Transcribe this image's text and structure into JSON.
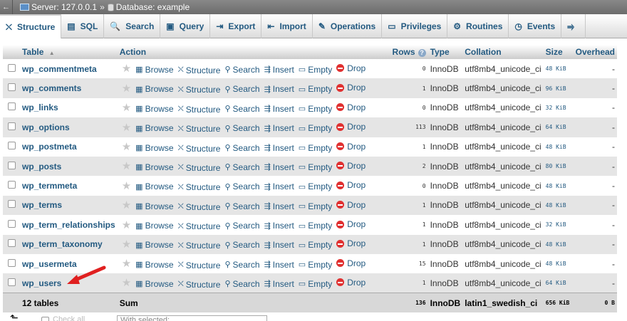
{
  "breadcrumb": {
    "back": "←",
    "server": "Server: 127.0.0.1",
    "separator": "»",
    "database": "Database: example"
  },
  "tabs": [
    {
      "label": "Structure",
      "icon": "structure-icon",
      "glyph": "⛌",
      "active": true
    },
    {
      "label": "SQL",
      "icon": "sql-icon",
      "glyph": "▤"
    },
    {
      "label": "Search",
      "icon": "search-icon",
      "glyph": "🔍"
    },
    {
      "label": "Query",
      "icon": "query-icon",
      "glyph": "▣"
    },
    {
      "label": "Export",
      "icon": "export-icon",
      "glyph": "⇥"
    },
    {
      "label": "Import",
      "icon": "import-icon",
      "glyph": "⇤"
    },
    {
      "label": "Operations",
      "icon": "operations-icon",
      "glyph": "✎"
    },
    {
      "label": "Privileges",
      "icon": "privileges-icon",
      "glyph": "▭"
    },
    {
      "label": "Routines",
      "icon": "routines-icon",
      "glyph": "⚙"
    },
    {
      "label": "Events",
      "icon": "events-icon",
      "glyph": "◷"
    },
    {
      "label": "",
      "icon": "triggers-icon",
      "glyph": "⥤"
    }
  ],
  "table": {
    "headers": {
      "table": "Table",
      "sort_indicator": "▲",
      "action": "Action",
      "rows": "Rows",
      "type": "Type",
      "collation": "Collation",
      "size": "Size",
      "overhead": "Overhead"
    },
    "actions": {
      "browse": "Browse",
      "structure": "Structure",
      "search": "Search",
      "insert": "Insert",
      "empty": "Empty",
      "drop": "Drop"
    },
    "rows": [
      {
        "name": "wp_commentmeta",
        "rows": "0",
        "type": "InnoDB",
        "collation": "utf8mb4_unicode_ci",
        "size": "48 KiB",
        "overhead": "-"
      },
      {
        "name": "wp_comments",
        "rows": "1",
        "type": "InnoDB",
        "collation": "utf8mb4_unicode_ci",
        "size": "96 KiB",
        "overhead": "-"
      },
      {
        "name": "wp_links",
        "rows": "0",
        "type": "InnoDB",
        "collation": "utf8mb4_unicode_ci",
        "size": "32 KiB",
        "overhead": "-"
      },
      {
        "name": "wp_options",
        "rows": "113",
        "type": "InnoDB",
        "collation": "utf8mb4_unicode_ci",
        "size": "64 KiB",
        "overhead": "-"
      },
      {
        "name": "wp_postmeta",
        "rows": "1",
        "type": "InnoDB",
        "collation": "utf8mb4_unicode_ci",
        "size": "48 KiB",
        "overhead": "-"
      },
      {
        "name": "wp_posts",
        "rows": "2",
        "type": "InnoDB",
        "collation": "utf8mb4_unicode_ci",
        "size": "80 KiB",
        "overhead": "-"
      },
      {
        "name": "wp_termmeta",
        "rows": "0",
        "type": "InnoDB",
        "collation": "utf8mb4_unicode_ci",
        "size": "48 KiB",
        "overhead": "-"
      },
      {
        "name": "wp_terms",
        "rows": "1",
        "type": "InnoDB",
        "collation": "utf8mb4_unicode_ci",
        "size": "48 KiB",
        "overhead": "-"
      },
      {
        "name": "wp_term_relationships",
        "rows": "1",
        "type": "InnoDB",
        "collation": "utf8mb4_unicode_ci",
        "size": "32 KiB",
        "overhead": "-"
      },
      {
        "name": "wp_term_taxonomy",
        "rows": "1",
        "type": "InnoDB",
        "collation": "utf8mb4_unicode_ci",
        "size": "48 KiB",
        "overhead": "-"
      },
      {
        "name": "wp_usermeta",
        "rows": "15",
        "type": "InnoDB",
        "collation": "utf8mb4_unicode_ci",
        "size": "48 KiB",
        "overhead": "-"
      },
      {
        "name": "wp_users",
        "rows": "1",
        "type": "InnoDB",
        "collation": "utf8mb4_unicode_ci",
        "size": "64 KiB",
        "overhead": "-"
      }
    ],
    "footer": {
      "count": "12 tables",
      "sum": "Sum",
      "rows": "136",
      "type": "InnoDB",
      "collation": "latin1_swedish_ci",
      "size": "656 KiB",
      "overhead": "0 B"
    }
  },
  "bottom": {
    "check_all": "Check all",
    "with_selected": "With selected:"
  },
  "colors": {
    "link": "#235a81",
    "annotation_arrow": "#e02020"
  }
}
